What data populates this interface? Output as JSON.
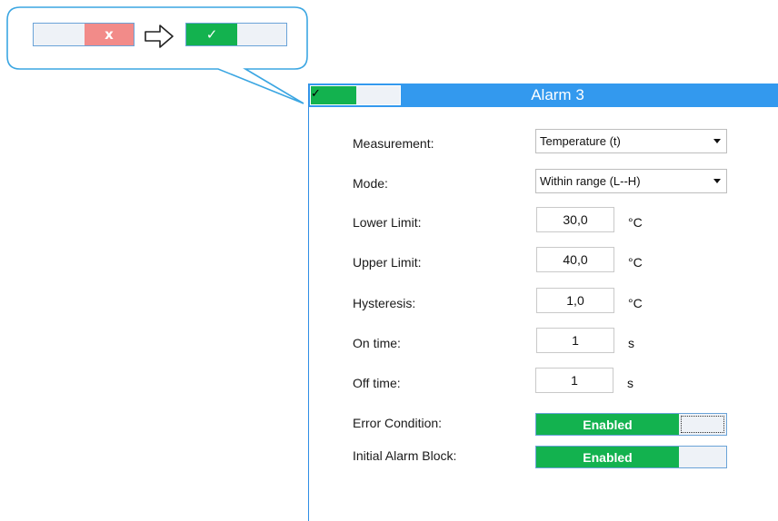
{
  "callout": {
    "before_toggle": {
      "active_label": "x",
      "active_color": "#f28b89"
    },
    "after_toggle": {
      "active_label": "✓",
      "active_color": "#13b24f"
    },
    "arrow_icon": "right-arrow-outline-icon"
  },
  "panel": {
    "title": "Alarm 3",
    "header_toggle": {
      "label": "✓"
    },
    "measurement": {
      "label": "Measurement:",
      "value": "Temperature (t)"
    },
    "mode": {
      "label": "Mode:",
      "value": "Within range (L--H)"
    },
    "lower_limit": {
      "label": "Lower Limit:",
      "value": "30,0",
      "unit": "°C"
    },
    "upper_limit": {
      "label": "Upper Limit:",
      "value": "40,0",
      "unit": "°C"
    },
    "hysteresis": {
      "label": "Hysteresis:",
      "value": "1,0",
      "unit": "°C"
    },
    "on_time": {
      "label": "On time:",
      "value": "1",
      "unit": "s"
    },
    "off_time": {
      "label": "Off time:",
      "value": "1",
      "unit": "s"
    },
    "error_condition": {
      "label": "Error Condition:",
      "state": "Enabled"
    },
    "initial_alarm_block": {
      "label": "Initial Alarm Block:",
      "state": "Enabled"
    }
  },
  "colors": {
    "accent_blue": "#3399ee",
    "enabled_green": "#13b24f",
    "disabled_red": "#f28b89"
  }
}
